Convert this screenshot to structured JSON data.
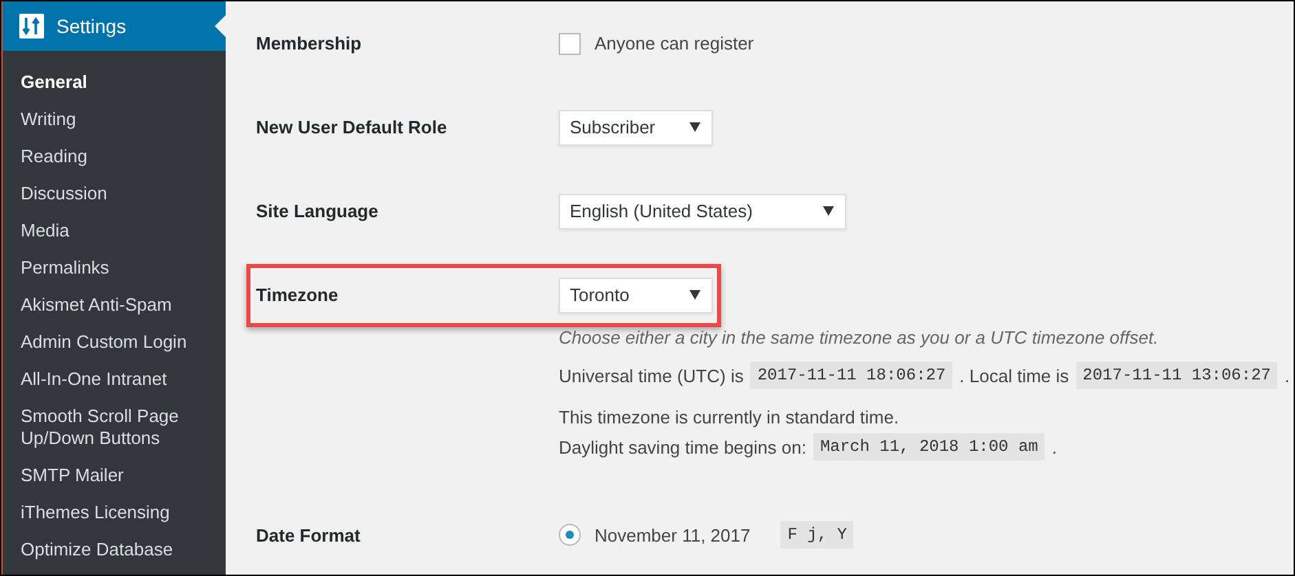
{
  "sidebar": {
    "title": "Settings",
    "items": [
      {
        "label": "General",
        "selected": true
      },
      {
        "label": "Writing",
        "selected": false
      },
      {
        "label": "Reading",
        "selected": false
      },
      {
        "label": "Discussion",
        "selected": false
      },
      {
        "label": "Media",
        "selected": false
      },
      {
        "label": "Permalinks",
        "selected": false
      },
      {
        "label": "Akismet Anti-Spam",
        "selected": false
      },
      {
        "label": "Admin Custom Login",
        "selected": false
      },
      {
        "label": "All-In-One Intranet",
        "selected": false
      },
      {
        "label": "Smooth Scroll Page Up/Down Buttons",
        "selected": false
      },
      {
        "label": "SMTP Mailer",
        "selected": false
      },
      {
        "label": "iThemes Licensing",
        "selected": false
      },
      {
        "label": "Optimize Database",
        "selected": false
      }
    ]
  },
  "rows": [
    {
      "kind": "checkbox",
      "label": "Membership",
      "option": "Anyone can register",
      "checked": false
    },
    {
      "kind": "select",
      "label": "New User Default Role",
      "value": "Subscriber"
    },
    {
      "kind": "select",
      "label": "Site Language",
      "value": "English (United States)"
    },
    {
      "kind": "select",
      "label": "Timezone",
      "value": "Toronto",
      "highlighted": true,
      "description": "Choose either a city in the same timezone as you or a UTC timezone offset.",
      "paragraphs": [
        [
          [
            {
              "kind": "text",
              "text": "Universal time (UTC) is"
            },
            {
              "kind": "code",
              "text": "2017-11-11 18:06:27"
            },
            {
              "kind": "text",
              "text": ". Local time is"
            },
            {
              "kind": "code",
              "text": "2017-11-11 13:06:27"
            },
            {
              "kind": "text",
              "text": "."
            }
          ]
        ],
        [
          [
            {
              "kind": "text",
              "text": "This timezone is currently in standard time."
            }
          ],
          [
            {
              "kind": "text",
              "text": "Daylight saving time begins on:"
            },
            {
              "kind": "code",
              "text": "March 11, 2018 1:00 am"
            },
            {
              "kind": "text",
              "text": "."
            }
          ]
        ]
      ]
    },
    {
      "kind": "radio",
      "label": "Date Format",
      "option": "November 11, 2017",
      "selected": true,
      "code": "F j, Y"
    }
  ]
}
